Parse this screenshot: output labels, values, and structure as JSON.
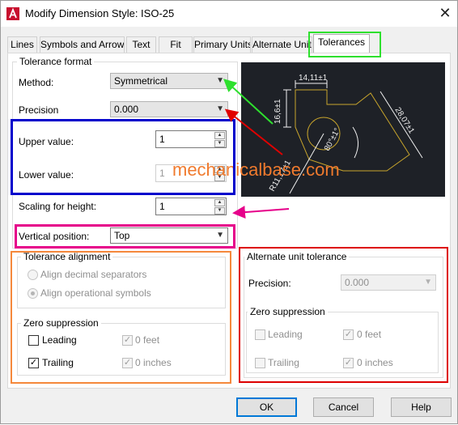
{
  "window": {
    "title": "Modify Dimension Style: ISO-25",
    "close_glyph": "✕"
  },
  "tabs": [
    {
      "label": "Lines"
    },
    {
      "label": "Symbols and Arrows"
    },
    {
      "label": "Text"
    },
    {
      "label": "Fit"
    },
    {
      "label": "Primary Units"
    },
    {
      "label": "Alternate Units"
    },
    {
      "label": "Tolerances",
      "active": true
    }
  ],
  "tolerance_format": {
    "label": "Tolerance format",
    "method_label": "Method:",
    "method_value": "Symmetrical",
    "precision_label": "Precision",
    "precision_value": "0.000",
    "upper_label": "Upper value:",
    "upper_value": "1",
    "lower_label": "Lower value:",
    "lower_value": "1",
    "scaling_label": "Scaling for height:",
    "scaling_value": "1",
    "vertical_label": "Vertical position:",
    "vertical_value": "Top"
  },
  "tolerance_alignment": {
    "label": "Tolerance alignment",
    "opt1": "Align decimal separators",
    "opt2": "Align operational symbols",
    "selected": "opt2"
  },
  "zero_suppression": {
    "label": "Zero suppression",
    "leading": "Leading",
    "trailing": "Trailing",
    "feet": "0 feet",
    "inches": "0 inches",
    "leading_checked": false,
    "trailing_checked": true,
    "feet_checked": true,
    "inches_checked": true
  },
  "alternate_unit_tolerance": {
    "label": "Alternate unit tolerance",
    "precision_label": "Precision:",
    "precision_value": "0.000",
    "zero_label": "Zero suppression",
    "leading": "Leading",
    "trailing": "Trailing",
    "feet": "0 feet",
    "inches": "0 inches"
  },
  "preview": {
    "dim_top": "14,11±1",
    "dim_left": "16,6±1",
    "dim_right": "28,07±1",
    "dim_angle": "80°±1°",
    "dim_radius": "R11,17±1"
  },
  "watermark": "mechanicalbase.com",
  "buttons": {
    "ok": "OK",
    "cancel": "Cancel",
    "help": "Help"
  },
  "colors": {
    "highlight_green": "#2ee02e",
    "highlight_blue": "#0000cc",
    "highlight_magenta": "#e6008a",
    "highlight_orange": "#f5883b",
    "highlight_red": "#dd0000",
    "arrow_red": "#e00000",
    "preview_bg": "#1e2127",
    "preview_geometry": "#c8a52c",
    "preview_dims": "#f0f0f0"
  }
}
